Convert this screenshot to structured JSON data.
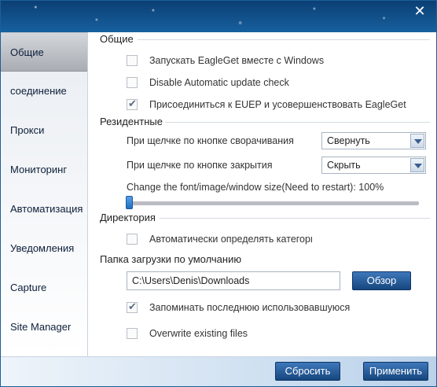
{
  "window": {
    "close_glyph": "✕"
  },
  "sidebar": {
    "items": [
      {
        "label": "Общие"
      },
      {
        "label": "соединение"
      },
      {
        "label": "Прокси"
      },
      {
        "label": "Мониторинг"
      },
      {
        "label": "Автоматизация"
      },
      {
        "label": "Уведомления"
      },
      {
        "label": "Capture"
      },
      {
        "label": "Site Manager"
      }
    ]
  },
  "general": {
    "title": "Общие",
    "options": [
      {
        "label": "Запускать EagleGet вместе с Windows",
        "checked": false
      },
      {
        "label": "Disable Automatic update check",
        "checked": false
      },
      {
        "label": "Присоединиться к EUEP и усовершенствовать EagleGet",
        "checked": true
      }
    ]
  },
  "resident": {
    "title": "Резидентные",
    "minimize_label": "При щелчке по кнопке сворачивания",
    "minimize_value": "Свернуть",
    "close_label": "При щелчке по кнопке закрытия",
    "close_value": "Скрыть",
    "size_label": "Change the font/image/window size(Need to restart): 100%",
    "size_percent": 100
  },
  "directory": {
    "title": "Директория",
    "auto_label": "Автоматически определять категории",
    "auto_checked": false,
    "default_folder_label": "Папка загрузки по умолчанию",
    "path_value": "C:\\Users\\Denis\\Downloads",
    "browse_label": "Обзор",
    "remember_label": "Запоминать последнюю использовавшуюся",
    "remember_checked": true,
    "overwrite_label": "Overwrite existing files",
    "overwrite_checked": false
  },
  "footer": {
    "reset_label": "Сбросить",
    "apply_label": "Применить"
  },
  "colors": {
    "titlebar": "#0d4c86",
    "button": "#16467e",
    "sidebar_active": "#a9adb3"
  },
  "icons": {
    "close": "close-icon",
    "check": "checkmark-icon",
    "dropdown": "chevron-down-icon"
  }
}
